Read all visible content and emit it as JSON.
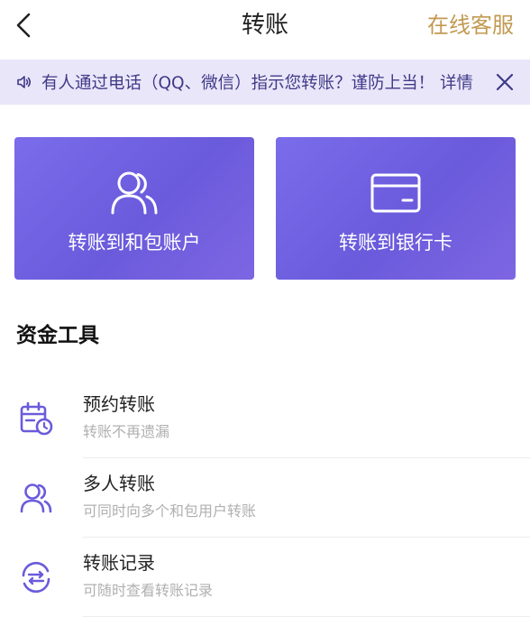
{
  "header": {
    "title": "转账",
    "service_label": "在线客服"
  },
  "notice": {
    "text": "有人通过电话（QQ、微信）指示您转账？谨防上当！ 详情"
  },
  "cards": [
    {
      "label": "转账到和包账户",
      "icon": "users-icon"
    },
    {
      "label": "转账到银行卡",
      "icon": "bank-card-icon"
    }
  ],
  "tools": {
    "section_title": "资金工具",
    "items": [
      {
        "name": "预约转账",
        "desc": "转账不再遗漏",
        "icon": "calendar-clock-icon"
      },
      {
        "name": "多人转账",
        "desc": "可同时向多个和包用户转账",
        "icon": "users-icon"
      },
      {
        "name": "转账记录",
        "desc": "可随时查看转账记录",
        "icon": "transfer-arrows-icon"
      }
    ]
  },
  "colors": {
    "accent": "#6a5bdc",
    "service_gold": "#c29a52",
    "notice_bg": "#eae6fa",
    "notice_text": "#3f3a86"
  }
}
